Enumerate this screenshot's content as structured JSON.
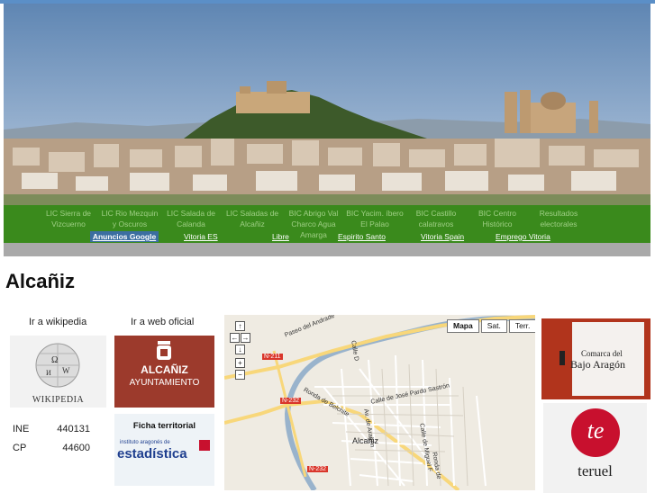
{
  "header": {
    "nav_items": [
      "LIC Sierra de Vizcuerno",
      "LIC Rio Mezquin y Oscuros",
      "LIC Salada de Calanda",
      "LIC Saladas de Alcañiz",
      "BIC Abrigo Val Charco Agua Amarga",
      "BIC Yacim. íbero El Palao",
      "BIC Castillo calatravos",
      "BIC Centro Histórico",
      "Resultados electorales"
    ],
    "ads_label": "Anuncios Google",
    "ad_links": [
      "Vitoria ES",
      "Libre",
      "Espirito Santo",
      "Vitoria Spain",
      "Emprego Vitoria"
    ]
  },
  "page": {
    "title": "Alcañiz"
  },
  "links": {
    "wikipedia_title": "Ir a wikipedia",
    "wikipedia_logo_text": "WIKIPEDIA",
    "web_title": "Ir a web oficial",
    "ayto_name": "ALCAÑIZ",
    "ayto_sub": "AYUNTAMIENTO"
  },
  "stats": [
    {
      "label": "INE",
      "value": "440131"
    },
    {
      "label": "CP",
      "value": "44600"
    }
  ],
  "ficha": {
    "title": "Ficha territorial",
    "org": "instituto aragonés de",
    "brand": "estadística"
  },
  "map": {
    "types": [
      "Mapa",
      "Sat.",
      "Terr."
    ],
    "controls": [
      "↑",
      "←",
      "→",
      "↓",
      "+",
      "−"
    ],
    "roads": [
      "N-211",
      "N-232",
      "N-232"
    ],
    "streets": [
      "Paseo del Andrade",
      "Ronda de Belchite",
      "Calle de José Pardo Sastrón",
      "Av. de Aragón",
      "Calle D",
      "Calle de Miguel F",
      "Ronda de"
    ],
    "town": "Alcañiz"
  },
  "sidebar": {
    "comarca_line1": "Comarca del",
    "comarca_line2": "Bajo Aragón",
    "teruel_logo": "te",
    "teruel_name": "teruel"
  },
  "colors": {
    "nav_green": "#3a8a1c",
    "ayto_red": "#9c3a2c",
    "comarca_red": "#b1341c",
    "teruel_red": "#c8102e"
  }
}
